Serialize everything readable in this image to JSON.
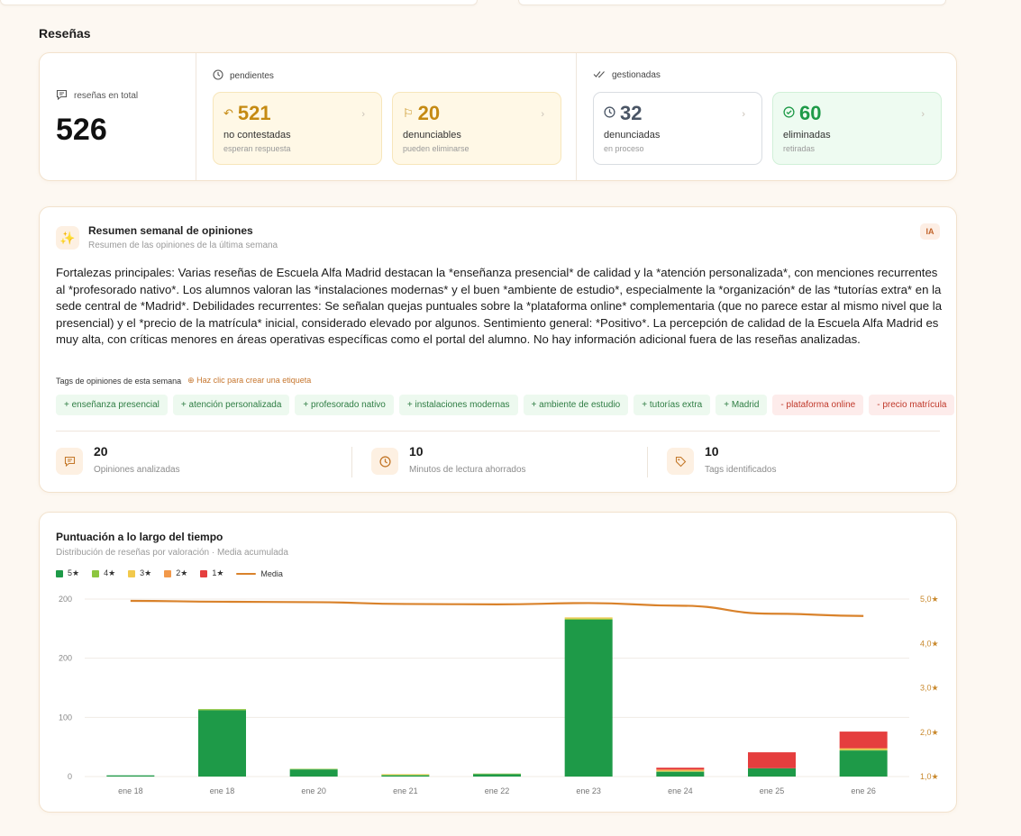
{
  "section_title": "Reseñas",
  "stats": {
    "total_label": "reseñas en total",
    "total_value": "526",
    "pending": {
      "title": "pendientes",
      "items": [
        {
          "value": "521",
          "label": "no contestadas",
          "sub": "esperan respuesta",
          "icon": "reply-icon"
        },
        {
          "value": "20",
          "label": "denunciables",
          "sub": "pueden eliminarse",
          "icon": "flag-icon"
        }
      ]
    },
    "managed": {
      "title": "gestionadas",
      "items": [
        {
          "value": "32",
          "label": "denunciadas",
          "sub": "en proceso",
          "icon": "clock-icon"
        },
        {
          "value": "60",
          "label": "eliminadas",
          "sub": "retiradas",
          "icon": "check-circle-icon"
        }
      ]
    }
  },
  "summary": {
    "title": "Resumen semanal de opiniones",
    "subtitle": "Resumen de las opiniones de la última semana",
    "badge": "IA",
    "text": "Fortalezas principales: Varias reseñas de Escuela Alfa Madrid destacan la *enseñanza presencial* de calidad y la *atención personalizada*, con menciones recurrentes al *profesorado nativo*. Los alumnos valoran las *instalaciones modernas* y el buen *ambiente de estudio*, especialmente la *organización* de las *tutorías extra* en la sede central de *Madrid*. Debilidades recurrentes: Se señalan quejas puntuales sobre la *plataforma online* complementaria (que no parece estar al mismo nivel que la presencial) y el *precio de la matrícula* inicial, considerado elevado por algunos. Sentimiento general: *Positivo*. La percepción de calidad de la Escuela Alfa Madrid es muy alta, con críticas menores en áreas operativas específicas como el portal del alumno. No hay información adicional fuera de las reseñas analizadas.",
    "tags_label": "Tags de opiniones de esta semana",
    "tags_hint": "Haz clic para crear una etiqueta",
    "tags": [
      {
        "label": "+ enseñanza presencial",
        "type": "pos"
      },
      {
        "label": "+ atención personalizada",
        "type": "pos"
      },
      {
        "label": "+ profesorado nativo",
        "type": "pos"
      },
      {
        "label": "+ instalaciones modernas",
        "type": "pos"
      },
      {
        "label": "+ ambiente de estudio",
        "type": "pos"
      },
      {
        "label": "+ tutorías extra",
        "type": "pos"
      },
      {
        "label": "+ Madrid",
        "type": "pos"
      },
      {
        "label": "- plataforma online",
        "type": "neg"
      },
      {
        "label": "- precio matrícula",
        "type": "neg"
      }
    ],
    "metrics": [
      {
        "value": "20",
        "label": "Opiniones analizadas",
        "icon": "message-icon"
      },
      {
        "value": "10",
        "label": "Minutos de lectura ahorrados",
        "icon": "clock-icon"
      },
      {
        "value": "10",
        "label": "Tags identificados",
        "icon": "tag-icon"
      }
    ]
  },
  "colors": {
    "s5": "#1e9a48",
    "s4": "#8cc63f",
    "s3": "#f2c94c",
    "s2": "#f2994a",
    "s1": "#e53e3e",
    "media": "#d9822b"
  },
  "chart_data": {
    "type": "bar",
    "title": "Puntuación a lo largo del tiempo",
    "subtitle": "Distribución de reseñas por valoración · Media acumulada",
    "categories": [
      "ene 18",
      "ene 18",
      "ene 20",
      "ene 21",
      "ene 22",
      "ene 23",
      "ene 24",
      "ene 25",
      "ene 26"
    ],
    "y_left_ticks": [
      "0",
      "100",
      "200",
      "200"
    ],
    "y_left_range": [
      0,
      300
    ],
    "y_right_ticks": [
      "1,0★",
      "2,0★",
      "3,0★",
      "4,0★",
      "5,0★"
    ],
    "y_right_range": [
      1,
      5
    ],
    "series": [
      {
        "name": "5★",
        "color": "#1e9a48",
        "values": [
          2,
          112,
          12,
          2,
          4,
          265,
          8,
          14,
          44
        ]
      },
      {
        "name": "4★",
        "color": "#8cc63f",
        "values": [
          0,
          2,
          1,
          1,
          1,
          2,
          1,
          0,
          1
        ]
      },
      {
        "name": "3★",
        "color": "#f2c94c",
        "values": [
          0,
          0,
          0,
          1,
          0,
          2,
          1,
          0,
          2
        ]
      },
      {
        "name": "2★",
        "color": "#f2994a",
        "values": [
          0,
          0,
          0,
          0,
          0,
          0,
          2,
          0,
          1
        ]
      },
      {
        "name": "1★",
        "color": "#e53e3e",
        "values": [
          0,
          0,
          0,
          0,
          0,
          0,
          3,
          27,
          28
        ]
      }
    ],
    "line": {
      "name": "Media",
      "color": "#d9822b",
      "values": [
        4.96,
        4.94,
        4.93,
        4.89,
        4.88,
        4.91,
        4.85,
        4.67,
        4.62
      ]
    },
    "grid": true,
    "legend": "top-left"
  }
}
